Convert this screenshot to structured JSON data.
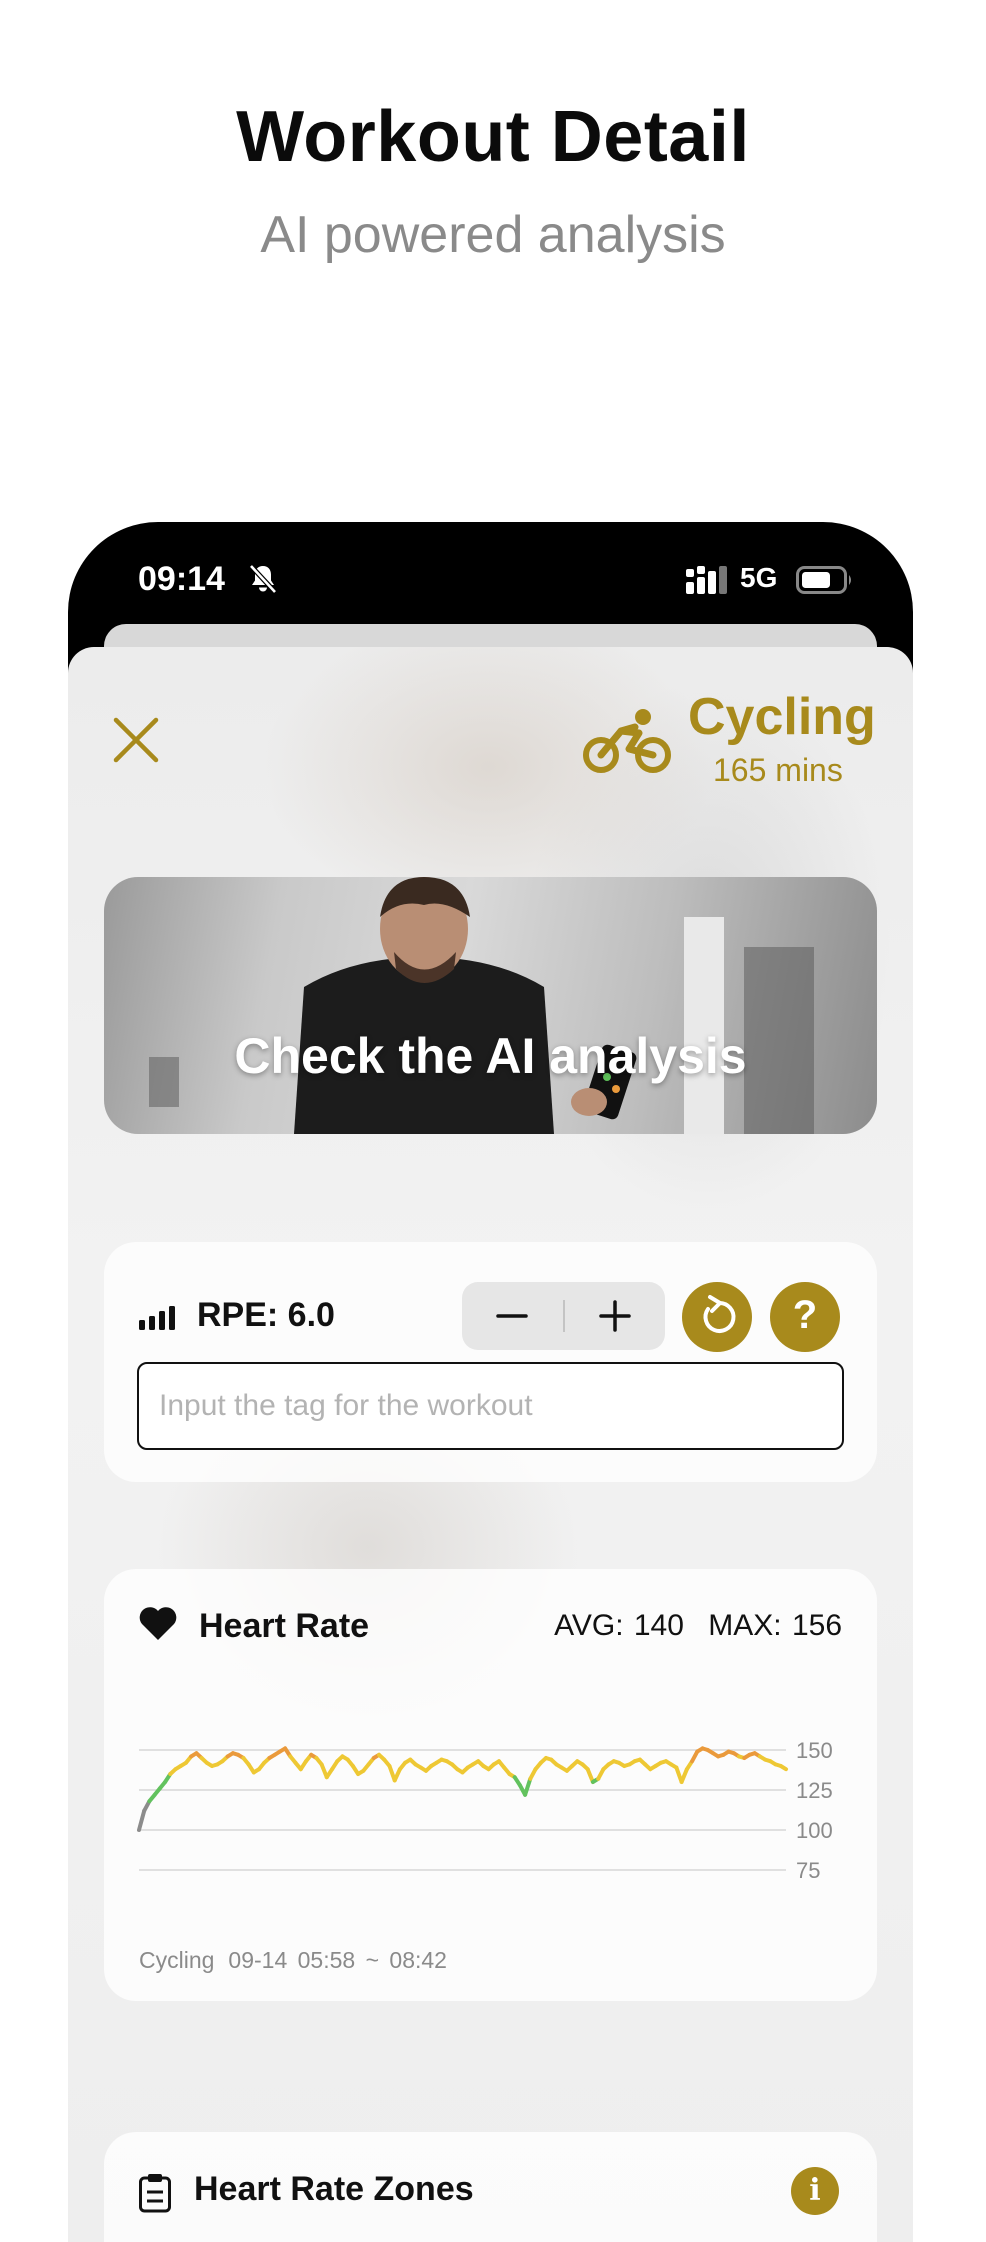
{
  "promo": {
    "title": "Workout Detail",
    "subtitle": "AI powered analysis"
  },
  "status_bar": {
    "time": "09:14",
    "network": "5G",
    "icons": [
      "bell-slash-icon",
      "signal-icon",
      "battery-icon"
    ]
  },
  "workout": {
    "activity": "Cycling",
    "duration": "165 mins",
    "icons": [
      "close-icon",
      "bicycle-icon"
    ]
  },
  "banner": {
    "title": "Check the AI analysis"
  },
  "rpe": {
    "label": "RPE: 6.0",
    "value": 6.0,
    "icons": [
      "signal-bars-icon",
      "minus-icon",
      "plus-icon",
      "refresh-icon",
      "question-icon"
    ],
    "help_glyph": "?",
    "tag_placeholder": "Input the tag for the workout"
  },
  "heart_rate": {
    "title": "Heart Rate",
    "avg_label": "AVG: 140",
    "max_label": "MAX: 156",
    "footer": {
      "activity": "Cycling",
      "date_range": "09-14 05:58  ~  08:42"
    }
  },
  "heart_rate_zones": {
    "title": "Heart Rate Zones",
    "info_glyph": "i"
  },
  "colors": {
    "accent": "#a88a1c",
    "zone_low_gray": "#8c8c8c",
    "zone_green": "#62c25e",
    "zone_yellow": "#eec834",
    "zone_orange": "#ea9a3c"
  },
  "chart_data": {
    "type": "line",
    "title": "Heart Rate",
    "xlabel": "",
    "ylabel": "",
    "x_range": [
      "05:58",
      "08:42"
    ],
    "y_ticks": [
      150,
      125,
      100,
      75
    ],
    "ylim": [
      75,
      158
    ],
    "grid": true,
    "series": [
      {
        "values": [
          100,
          112,
          118,
          122,
          126,
          130,
          135,
          138,
          140,
          142,
          146,
          148,
          145,
          142,
          140,
          141,
          143,
          146,
          148,
          147,
          145,
          141,
          136,
          138,
          142,
          145,
          147,
          149,
          151,
          146,
          142,
          138,
          143,
          147,
          145,
          141,
          133,
          138,
          143,
          146,
          144,
          140,
          135,
          137,
          141,
          145,
          147,
          144,
          140,
          131,
          138,
          142,
          144,
          141,
          139,
          137,
          140,
          142,
          144,
          143,
          141,
          138,
          136,
          139,
          141,
          143,
          140,
          138,
          141,
          143,
          139,
          135,
          133,
          128,
          122,
          132,
          138,
          142,
          145,
          144,
          141,
          139,
          137,
          140,
          143,
          141,
          138,
          130,
          132,
          138,
          141,
          143,
          142,
          140,
          141,
          143,
          144,
          141,
          138,
          140,
          142,
          143,
          141,
          139,
          130,
          138,
          143,
          149,
          151,
          150,
          148,
          146,
          147,
          149,
          148,
          146,
          145,
          147,
          148,
          146,
          144,
          143,
          141,
          140,
          138
        ]
      }
    ]
  }
}
